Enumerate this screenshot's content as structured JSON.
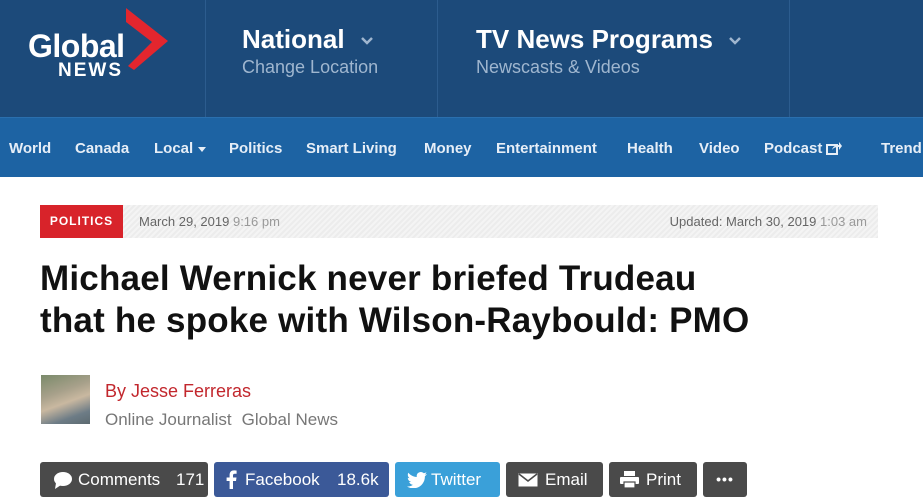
{
  "header": {
    "logo_top": "Global",
    "logo_bottom": "NEWS",
    "region": {
      "title": "National",
      "subtitle": "Change Location"
    },
    "programs": {
      "title": "TV News Programs",
      "subtitle": "Newscasts & Videos"
    }
  },
  "nav": {
    "items": [
      "World",
      "Canada",
      "Local",
      "Politics",
      "Smart Living",
      "Money",
      "Entertainment",
      "Health",
      "Video",
      "Podcast",
      "Trend"
    ]
  },
  "article": {
    "category": "POLITICS",
    "published_date": "March 29, 2019",
    "published_time": "9:16 pm",
    "updated_label": "Updated: March 30, 2019",
    "updated_time": "1:03 am",
    "headline_line1": "Michael Wernick never briefed Trudeau",
    "headline_line2": "that he spoke with Wilson-Raybould: PMO",
    "byline": "By Jesse Ferreras",
    "role": "Online Journalist",
    "outlet": "Global News"
  },
  "share": {
    "comments": {
      "label": "Comments",
      "count": "171"
    },
    "facebook": {
      "label": "Facebook",
      "count": "18.6k"
    },
    "twitter": {
      "label": "Twitter"
    },
    "email": {
      "label": "Email"
    },
    "print": {
      "label": "Print"
    },
    "more": {
      "label": "•••"
    }
  },
  "colors": {
    "header_bg": "#1c4a7a",
    "nav_bg": "#1d63a3",
    "badge_red": "#d8232a",
    "byline_red": "#c2272d",
    "facebook_blue": "#3b5998",
    "twitter_blue": "#3aa0d9",
    "button_dark": "#4a4a4a"
  }
}
